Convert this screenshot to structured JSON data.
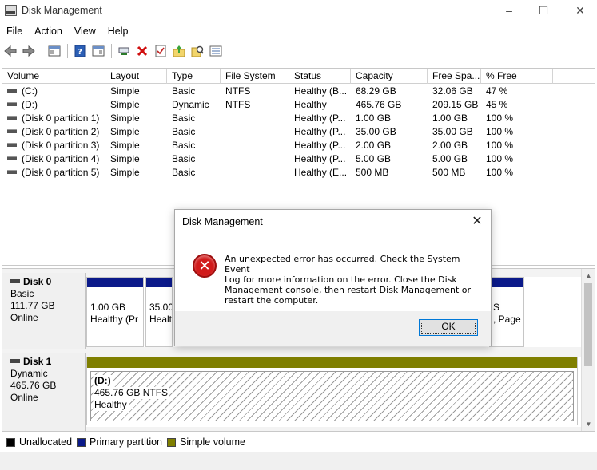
{
  "window": {
    "title": "Disk Management"
  },
  "menu": [
    "File",
    "Action",
    "View",
    "Help"
  ],
  "toolbar_icons": [
    "back-arrow-icon",
    "forward-arrow-icon",
    "console-tree-icon",
    "help-icon",
    "show-pane-icon",
    "connect-icon",
    "delete-icon",
    "properties-icon",
    "up-folder-icon",
    "search-icon",
    "list-icon"
  ],
  "volume_table": {
    "columns": [
      "Volume",
      "Layout",
      "Type",
      "File System",
      "Status",
      "Capacity",
      "Free Spa...",
      "% Free"
    ],
    "rows": [
      [
        "(C:)",
        "Simple",
        "Basic",
        "NTFS",
        "Healthy (B...",
        "68.29 GB",
        "32.06 GB",
        "47 %"
      ],
      [
        "(D:)",
        "Simple",
        "Dynamic",
        "NTFS",
        "Healthy",
        "465.76 GB",
        "209.15 GB",
        "45 %"
      ],
      [
        "(Disk 0 partition 1)",
        "Simple",
        "Basic",
        "",
        "Healthy (P...",
        "1.00 GB",
        "1.00 GB",
        "100 %"
      ],
      [
        "(Disk 0 partition 2)",
        "Simple",
        "Basic",
        "",
        "Healthy (P...",
        "35.00 GB",
        "35.00 GB",
        "100 %"
      ],
      [
        "(Disk 0 partition 3)",
        "Simple",
        "Basic",
        "",
        "Healthy (P...",
        "2.00 GB",
        "2.00 GB",
        "100 %"
      ],
      [
        "(Disk 0 partition 4)",
        "Simple",
        "Basic",
        "",
        "Healthy (P...",
        "5.00 GB",
        "5.00 GB",
        "100 %"
      ],
      [
        "(Disk 0 partition 5)",
        "Simple",
        "Basic",
        "",
        "Healthy (E...",
        "500 MB",
        "500 MB",
        "100 %"
      ]
    ]
  },
  "disks": [
    {
      "name": "Disk 0",
      "type": "Basic",
      "size": "111.77 GB",
      "status": "Online",
      "partitions": [
        {
          "size": "1.00 GB",
          "status": "Healthy (Pr"
        },
        {
          "size": "35.00",
          "status": "Healt"
        },
        {
          "size": "S",
          "status": ", Page"
        }
      ]
    },
    {
      "name": "Disk 1",
      "type": "Dynamic",
      "size": "465.76 GB",
      "status": "Online",
      "volume": {
        "label": "(D:)",
        "detail": "465.76 GB NTFS",
        "status": "Healthy"
      }
    }
  ],
  "legend": [
    {
      "label": "Unallocated",
      "color": "#000000"
    },
    {
      "label": "Primary partition",
      "color": "#0b1a8a"
    },
    {
      "label": "Simple volume",
      "color": "#7f7f00"
    }
  ],
  "dialog": {
    "title": "Disk Management",
    "message_lines": [
      "An unexpected error has occurred. Check the System Event",
      "Log for more information on the error. Close the Disk",
      "Management console, then restart Disk Management or",
      "restart the computer."
    ],
    "ok_label": "OK"
  }
}
